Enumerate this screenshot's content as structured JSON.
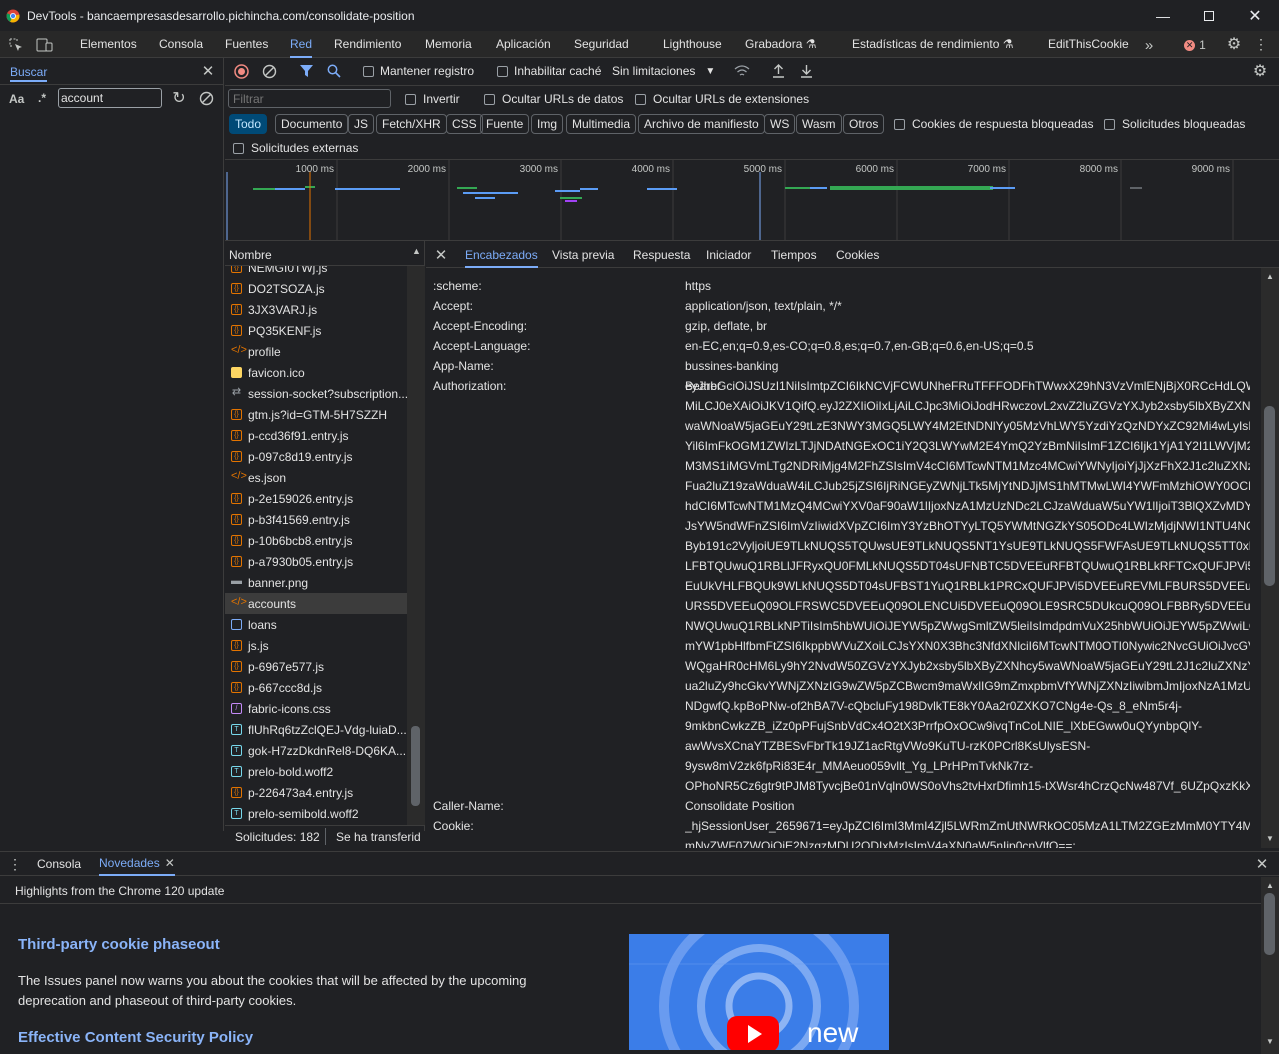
{
  "window": {
    "title": "DevTools - bancaempresasdesarrollo.pichincha.com/consolidate-position"
  },
  "main_tabs": [
    "Elementos",
    "Consola",
    "Fuentes",
    "Red",
    "Rendimiento",
    "Memoria",
    "Aplicación",
    "Seguridad",
    "Lighthouse",
    "Grabadora ⚗",
    "Estadísticas de rendimiento ⚗",
    "EditThisCookie"
  ],
  "error_count": "1",
  "search": {
    "tab_label": "Buscar",
    "case_label": "Aa",
    "regex_label": ".*",
    "query": "account"
  },
  "network_toolbar": {
    "preserve_log": "Mantener registro",
    "disable_cache": "Inhabilitar caché",
    "throttling": "Sin limitaciones"
  },
  "filter": {
    "placeholder": "Filtrar",
    "invert": "Invertir",
    "hide_data_urls": "Ocultar URLs de datos",
    "hide_ext_urls": "Ocultar URLs de extensiones",
    "blocked_cookies": "Cookies de respuesta bloqueadas",
    "blocked_requests": "Solicitudes bloqueadas",
    "third_party": "Solicitudes externas"
  },
  "type_chips": [
    "Todo",
    "Documento",
    "JS",
    "Fetch/XHR",
    "CSS",
    "Fuente",
    "Img",
    "Multimedia",
    "Archivo de manifiesto",
    "WS",
    "Wasm",
    "Otros"
  ],
  "overview_ticks": [
    "1000 ms",
    "2000 ms",
    "3000 ms",
    "4000 ms",
    "5000 ms",
    "6000 ms",
    "7000 ms",
    "8000 ms",
    "9000 ms"
  ],
  "list": {
    "header": "Nombre",
    "items": [
      {
        "name": "NEMGI0TWj.js",
        "type": "js"
      },
      {
        "name": "DO2TSOZA.js",
        "type": "js"
      },
      {
        "name": "3JX3VARJ.js",
        "type": "js"
      },
      {
        "name": "PQ35KENF.js",
        "type": "js"
      },
      {
        "name": "profile",
        "type": "fetch"
      },
      {
        "name": "favicon.ico",
        "type": "img"
      },
      {
        "name": "session-socket?subscription...",
        "type": "ws"
      },
      {
        "name": "gtm.js?id=GTM-5H7SZZH",
        "type": "js"
      },
      {
        "name": "p-ccd36f91.entry.js",
        "type": "js"
      },
      {
        "name": "p-097c8d19.entry.js",
        "type": "js"
      },
      {
        "name": "es.json",
        "type": "fetch"
      },
      {
        "name": "p-2e159026.entry.js",
        "type": "js"
      },
      {
        "name": "p-b3f41569.entry.js",
        "type": "js"
      },
      {
        "name": "p-10b6bcb8.entry.js",
        "type": "js"
      },
      {
        "name": "p-a7930b05.entry.js",
        "type": "js"
      },
      {
        "name": "banner.png",
        "type": "imgdash"
      },
      {
        "name": "accounts",
        "type": "fetch"
      },
      {
        "name": "loans",
        "type": "doc"
      },
      {
        "name": "js.js",
        "type": "js"
      },
      {
        "name": "p-6967e577.js",
        "type": "js"
      },
      {
        "name": "p-667ccc8d.js",
        "type": "js"
      },
      {
        "name": "fabric-icons.css",
        "type": "css"
      },
      {
        "name": "flUhRq6tzZclQEJ-Vdg-luiaD...",
        "type": "font"
      },
      {
        "name": "gok-H7zzDkdnRel8-DQ6KA...",
        "type": "font"
      },
      {
        "name": "prelo-bold.woff2",
        "type": "font"
      },
      {
        "name": "p-226473a4.entry.js",
        "type": "js"
      },
      {
        "name": "prelo-semibold.woff2",
        "type": "font"
      }
    ],
    "status_requests": "Solicitudes: 182",
    "status_transferred": "Se ha transferid"
  },
  "detail_tabs": [
    "Encabezados",
    "Vista previa",
    "Respuesta",
    "Iniciador",
    "Tiempos",
    "Cookies"
  ],
  "headers": [
    {
      "k": ":scheme:",
      "v": "https"
    },
    {
      "k": "Accept:",
      "v": "application/json, text/plain, */*"
    },
    {
      "k": "Accept-Encoding:",
      "v": "gzip, deflate, br"
    },
    {
      "k": "Accept-Language:",
      "v": "en-EC,en;q=0.9,es-CO;q=0.8,es;q=0.7,en-GB;q=0.6,en-US;q=0.5"
    },
    {
      "k": "App-Name:",
      "v": "bussines-banking"
    },
    {
      "k": "Authorization:",
      "v": "Bearer"
    }
  ],
  "token_lines": [
    "eyJhbGciOiJSUzI1NiIsImtpZCI6IkNCVjFCWUNheFRuTFFFODFhTWwxX29hN3VzVmlENjBjX0RCcHdLQWd1an",
    "MiLCJ0eXAiOiJKV1QifQ.eyJ2ZXIiOiIxLjAiLCJpc3MiOiJodHRwczovL2xvZ2luZGVzYXJyb2xsby5lbXByZXNhcy5",
    "waWNoaW5jaGEuY29tLzE3NWY3MGQ5LWY4M2EtNDNlYy05MzVhLWY5YzdiYzQzNDYxZC92Mi4wLyIsInN1",
    "Yil6ImFkOGM1ZWIzLTJjNDAtNGExOC1iY2Q3LWYwM2E4YmQ2YzBmNiIsImF1ZCI6Ijk1YjA1Y2I1LWVjM2ItND",
    "M3MS1iMGVmLTg2NDRiMjg4M2FhZSIsImV4cCI6MTcwNTM1Mzc4MCwiYWNyIjoiYjJjXzFhX2J1c2luZXNzYm",
    "Fua2luZ19zaWduaW4iLCJub25jZSI6IjRiNGEyZWNjLTk5MjYtNDJjMS1hMTMwLWI4YWFmMzhiOWY0OCIsImI",
    "hdCI6MTcwNTM1MzQ4MCwiYXV0aF90aW1lIjoxNzA1MzUzNDc2LCJzaWduaW5uYW1lIjoiT3BlQXZvMDYiLC",
    "JsYW5ndWFnZSI6ImVzIiwidXVpZCI6ImY3YzBhOTYyLTQ5YWMtNGZkYS05ODc4LWIzMjdjNWI1NTU4NCIsIn",
    "Byb191c2VyljoiUE9TLkNUQS5TQUwsUE9TLkNUQS5NT1YsUE9TLkNUQS5FWFAsUE9TLkNUQS5TT0xDRVJU",
    "LFBTQUwuQ1RBLlJFRyxQU0FMLkNUQS5DT04sUFNBTC5DVEEuRFBTQUwuQ1RBLkRFTCxQUFJPVi5DVE",
    "EuUkVHLFBQUk9WLkNUQS5DT04sUFBST1YuQ1RBLk1PRCxQUFJPVi5DVEEuREVMLFBURS5DVEEuUkVHLFB",
    "URS5DVEEuQ09OLFRSWC5DVEEuQ09OLENCUi5DVEEuQ09OLE9SRC5DUkcuQ09OLFBBRy5DVEEuQ09OLE",
    "NWQUwuQ1RBLkNPTiIsIm5hbWUiOiJEYW5pZWwgSmltZW5leiIsImdpdmVuX25hbWUiOiJEYW5pZWwiLCJ",
    "mYW1pbHlfbmFtZSI6IkppbWVuZXoiLCJsYXN0X3Bhc3NfdXNlciI6MTcwNTM0OTI0Nywic2NvcGUiOiJvcGVua",
    "WQgaHR0cHM6Ly9hY2NvdW50ZGVzYXJyb2xsby5lbXByZXNhcy5waWNoaW5jaGEuY29tL2J1c2luZXNzYmF",
    "ua2luZy9hcGkvYWNjZXNzIG9wZW5pZCBwcm9maWxlIG9mZmxpbmVfYWNjZXNzIiwibmJmIjoxNzA1MzUz",
    "NDgwfQ.kpBoPNw-of2hBA7V-cQbcluFy198DvlkTE8kY0Aa2r0ZXKO7CNg4e-Qs_8_eNm5r4j-",
    "9mkbnCwkzZB_iZz0pPFujSnbVdCx4O2tX3PrrfpOxOCw9ivqTnCoLNIE_lXbEGww0uQYynbpQlY-",
    "awWvsXCnaYTZBESvFbrTk19JZ1acRtgVWo9KuTU-rzK0PCrl8KsUlysESN-",
    "9ysw8mV2zk6fpRi83E4r_MMAeuo059vllt_Yg_LPrHPmTvkNk7rz-",
    "OPhoNR5Cz6gtr9tPJM8TyvcjBe01nVqln0WS0oVhs2tvHxrDfimh15-tXWsr4hCrzQcNw487Vf_6UZpQxzKkXlw"
  ],
  "headers_after": [
    {
      "k": "Caller-Name:",
      "v": "Consolidate Position"
    },
    {
      "k": "Cookie:",
      "v": "_hjSessionUser_2659671=eyJpZCI6ImI3MmI4Zjl5LWRmZmUtNWRkOC05MzA1LTM2ZGEzMmM0YTY4MSIsI"
    }
  ],
  "cookie_line2": "mNvZWF0ZWQiOjE2NzgzMDU2ODIxMzIsImV4aXN0aW5nIjp0cnVlfQ==;",
  "drawer": {
    "tabs": [
      "Consola",
      "Novedades"
    ],
    "highlight": "Highlights from the Chrome 120 update",
    "h1": "Third-party cookie phaseout",
    "p1a": "The Issues panel now warns you about the cookies that will be affected by the upcoming",
    "p1b": "deprecation and phaseout of third-party cookies.",
    "h2": "Effective Content Security Policy",
    "video_word": "new"
  },
  "colors": {
    "accent": "#7cacf8",
    "link_heading": "#8ab4f8",
    "video_bg": "#3b7de8",
    "yt_red": "#ff0000"
  }
}
